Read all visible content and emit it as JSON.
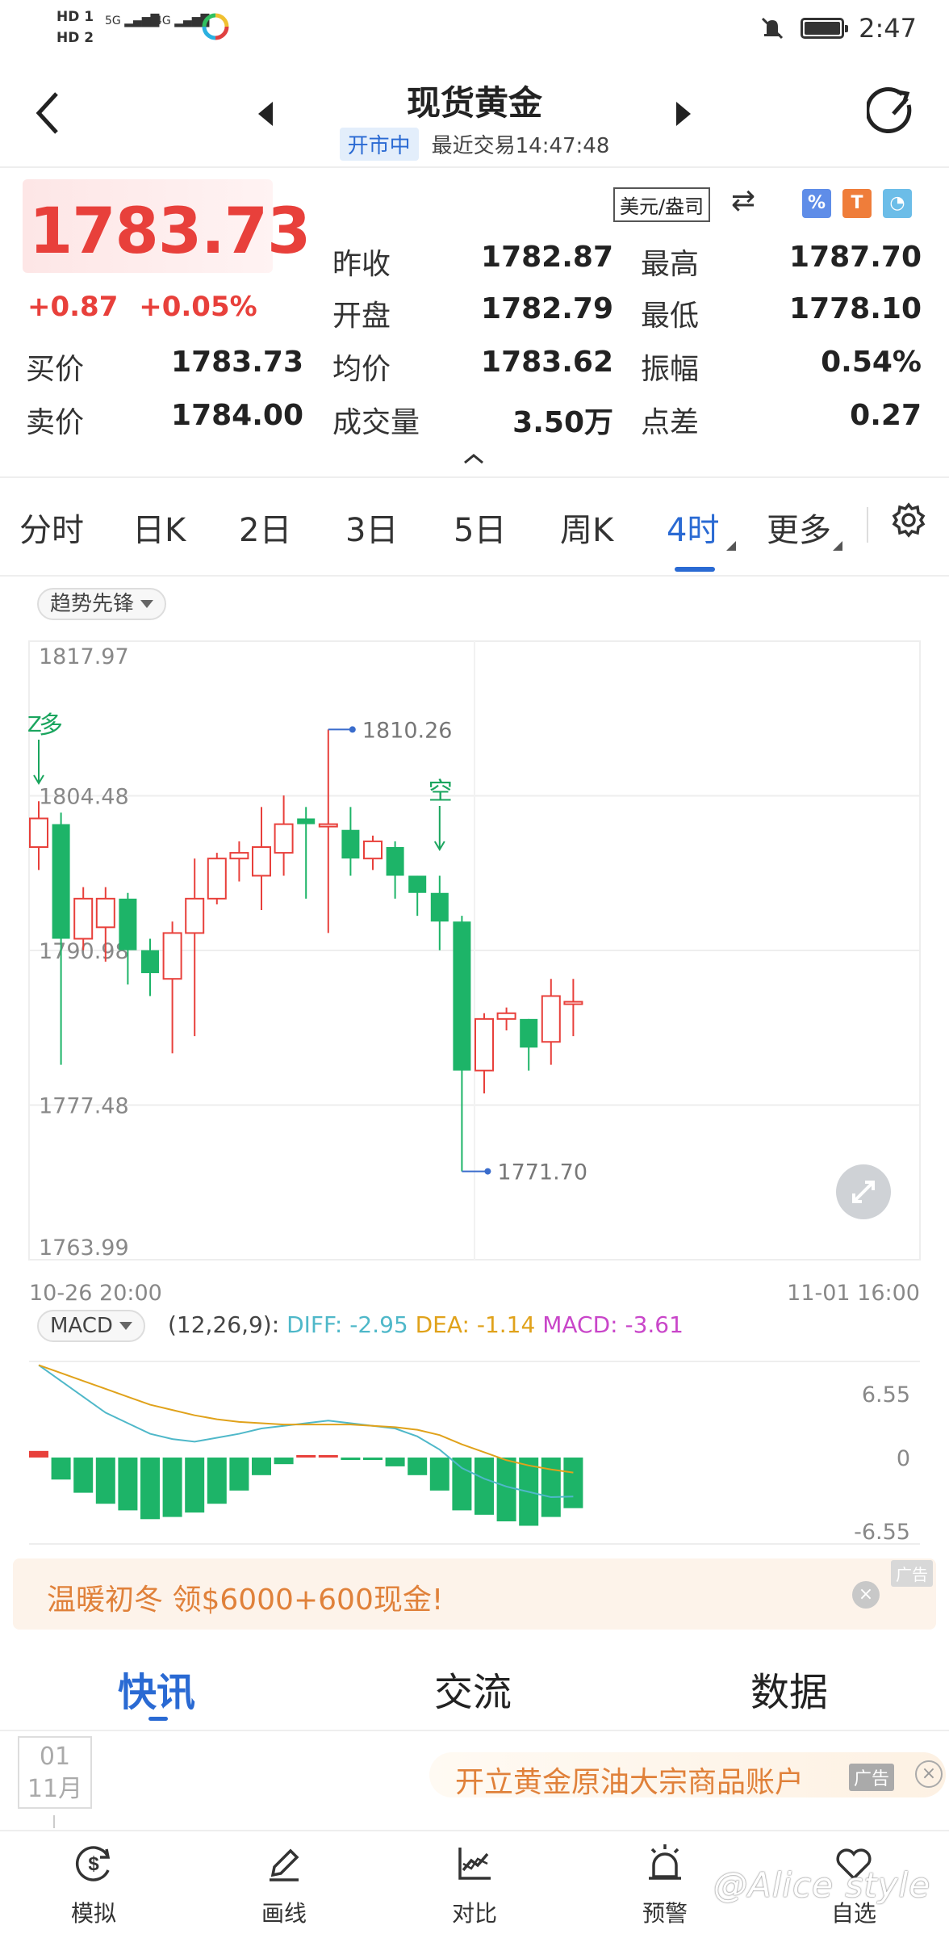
{
  "status_bar": {
    "left_top": "HD 1",
    "left_bottom": "HD 2",
    "sim1": "5G",
    "sim2": "4G",
    "time": "2:47",
    "icons": [
      "hd-icon",
      "signal-icon",
      "app-notification-icon",
      "mute-icon",
      "battery-icon"
    ]
  },
  "header": {
    "title": "现货黄金",
    "market_status": "开市中",
    "last_trade": "最近交易14:47:48"
  },
  "quote": {
    "price": "1783.73",
    "change": "+0.87",
    "change_pct": "+0.05%",
    "unit": "美元/盎司",
    "rows": [
      {
        "label": "昨收",
        "value": "1782.87",
        "label2": "最高",
        "value2": "1787.70"
      },
      {
        "label": "开盘",
        "value": "1782.79",
        "label2": "最低",
        "value2": "1778.10"
      },
      {
        "label": "均价",
        "value": "1783.62",
        "label2": "振幅",
        "value2": "0.54%"
      },
      {
        "label": "成交量",
        "value": "3.50万",
        "label2": "点差",
        "value2": "0.27"
      }
    ],
    "bid_label": "买价",
    "bid": "1783.73",
    "ask_label": "卖价",
    "ask": "1784.00",
    "colors": {
      "up": "#e8403b",
      "down": "#1db468"
    }
  },
  "tabs": {
    "items": [
      "分时",
      "日K",
      "2日",
      "3日",
      "5日",
      "周K",
      "4时",
      "更多"
    ],
    "active": "4时"
  },
  "chart": {
    "indicator": "趋势先锋",
    "macd_indicator": "MACD",
    "macd_params": "(12,26,9):",
    "diff": "DIFF: -2.95",
    "dea": "DEA: -1.14",
    "macd": "MACD: -3.61",
    "long_signal": "多",
    "long_signal_prefix": "Z",
    "short_signal": "空",
    "high_mark": "1810.26",
    "low_mark": "1771.70",
    "x_start": "10-26 20:00",
    "x_end": "11-01 16:00",
    "macd_y_labels": [
      "6.55",
      "0",
      "-6.55"
    ]
  },
  "chart_data": {
    "type": "candlestick",
    "y_ticks": [
      "1817.97",
      "1804.48",
      "1790.98",
      "1777.48",
      "1763.99"
    ],
    "ylim": [
      1763.99,
      1817.97
    ],
    "x_range": [
      "10-26 20:00",
      "11-01 16:00"
    ],
    "candles": [
      {
        "o": 1800.0,
        "c": 1802.5,
        "h": 1804.0,
        "l": 1798.0
      },
      {
        "o": 1802.0,
        "c": 1792.0,
        "h": 1803.0,
        "l": 1781.0
      },
      {
        "o": 1792.0,
        "c": 1795.5,
        "h": 1796.5,
        "l": 1791.0
      },
      {
        "o": 1793.0,
        "c": 1795.5,
        "h": 1796.5,
        "l": 1790.0
      },
      {
        "o": 1795.5,
        "c": 1791.0,
        "h": 1796.0,
        "l": 1788.0
      },
      {
        "o": 1791.0,
        "c": 1789.0,
        "h": 1792.0,
        "l": 1787.0
      },
      {
        "o": 1788.5,
        "c": 1792.5,
        "h": 1793.5,
        "l": 1782.0
      },
      {
        "o": 1792.5,
        "c": 1795.5,
        "h": 1799.0,
        "l": 1783.5
      },
      {
        "o": 1795.5,
        "c": 1799.0,
        "h": 1799.5,
        "l": 1795.0
      },
      {
        "o": 1799.0,
        "c": 1799.5,
        "h": 1800.5,
        "l": 1797.0
      },
      {
        "o": 1797.5,
        "c": 1800.0,
        "h": 1803.5,
        "l": 1794.5
      },
      {
        "o": 1799.5,
        "c": 1802.0,
        "h": 1804.5,
        "l": 1797.5
      },
      {
        "o": 1802.5,
        "c": 1802.0,
        "h": 1803.5,
        "l": 1795.5
      },
      {
        "o": 1802.0,
        "c": 1802.0,
        "h": 1810.26,
        "l": 1792.5
      },
      {
        "o": 1801.5,
        "c": 1799.0,
        "h": 1803.5,
        "l": 1797.5
      },
      {
        "o": 1799.0,
        "c": 1800.5,
        "h": 1801.0,
        "l": 1798.0
      },
      {
        "o": 1800.0,
        "c": 1797.5,
        "h": 1800.5,
        "l": 1795.5
      },
      {
        "o": 1797.5,
        "c": 1796.0,
        "h": 1797.5,
        "l": 1794.0
      },
      {
        "o": 1796.0,
        "c": 1793.5,
        "h": 1797.5,
        "l": 1791.0
      },
      {
        "o": 1793.5,
        "c": 1780.5,
        "h": 1794.0,
        "l": 1771.7
      },
      {
        "o": 1780.5,
        "c": 1785.0,
        "h": 1785.5,
        "l": 1778.5
      },
      {
        "o": 1785.0,
        "c": 1785.5,
        "h": 1786.0,
        "l": 1784.0
      },
      {
        "o": 1785.0,
        "c": 1782.5,
        "h": 1785.0,
        "l": 1780.5
      },
      {
        "o": 1783.0,
        "c": 1787.0,
        "h": 1788.5,
        "l": 1781.0
      },
      {
        "o": 1786.5,
        "c": 1786.5,
        "h": 1788.5,
        "l": 1783.5
      }
    ],
    "macd": {
      "ylim": [
        -6.55,
        6.55
      ],
      "y_ticks": [
        "6.55",
        "0",
        "-6.55"
      ],
      "hist": [
        0.6,
        -2.0,
        -3.2,
        -4.2,
        -4.8,
        -5.6,
        -5.4,
        -5.0,
        -4.2,
        -3.0,
        -1.6,
        -0.6,
        0,
        0.2,
        -0.2,
        -0.2,
        -0.8,
        -1.6,
        -3.0,
        -4.8,
        -5.2,
        -5.8,
        -6.2,
        -5.4,
        -4.6
      ],
      "diff": [
        7.0,
        5.8,
        4.6,
        3.4,
        2.6,
        1.8,
        1.4,
        1.2,
        1.5,
        1.8,
        2.2,
        2.4,
        2.6,
        2.8,
        2.6,
        2.4,
        2.2,
        1.6,
        0.6,
        -0.8,
        -1.6,
        -2.2,
        -2.6,
        -3.0,
        -2.95
      ],
      "dea": [
        7.0,
        6.4,
        5.8,
        5.2,
        4.6,
        4.0,
        3.6,
        3.2,
        2.9,
        2.7,
        2.6,
        2.5,
        2.5,
        2.5,
        2.5,
        2.4,
        2.3,
        2.1,
        1.7,
        1.0,
        0.4,
        -0.2,
        -0.6,
        -0.9,
        -1.14
      ],
      "colors": {
        "diff": "#4fb8c9",
        "dea": "#e0a21b",
        "macd": "#c946c9"
      }
    }
  },
  "ad": {
    "text": "温暖初冬 领$6000+600现金!",
    "tag": "广告",
    "close": "×"
  },
  "news_tabs": {
    "items": [
      "快讯",
      "交流",
      "数据"
    ],
    "active": "快讯"
  },
  "feed": {
    "date_day": "01",
    "date_month": "11月",
    "ad_text": "开立黄金原油大宗商品账户",
    "ad_tag": "广告",
    "ad_close": "×"
  },
  "bottom_nav": {
    "items": [
      {
        "label": "模拟",
        "icon": "dollar-refresh-icon"
      },
      {
        "label": "画线",
        "icon": "pen-icon"
      },
      {
        "label": "对比",
        "icon": "chart-compare-icon"
      },
      {
        "label": "预警",
        "icon": "alarm-icon"
      },
      {
        "label": "自选",
        "icon": "heart-icon"
      }
    ]
  },
  "watermark": "@Alice style"
}
